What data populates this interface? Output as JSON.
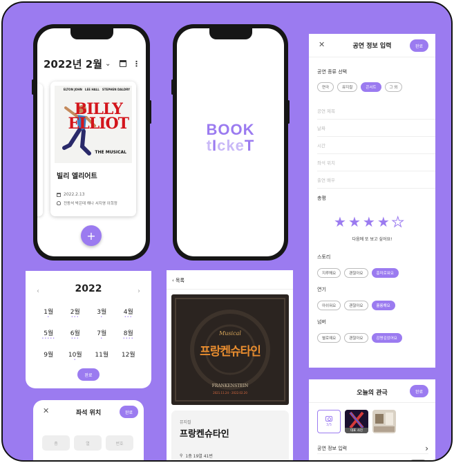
{
  "colors": {
    "accent": "#9b7bf0",
    "frame_border": "#111111"
  },
  "list_screen": {
    "month_title": "2022년 2월",
    "chevron_icon": "chevron-down-icon",
    "calendar_icon": "calendar-icon",
    "menu_icon": "kebab-menu-icon",
    "card": {
      "poster": {
        "cast": [
          "ELTON JOHN",
          "LEE HALL",
          "STEPHEN DALDRY"
        ],
        "title_line1": "BILLY",
        "title_line2": "ELLIOT",
        "subtitle": "THE MUSICAL"
      },
      "name": "빌리 엘리어트",
      "date": "2022.2.13",
      "cast": "전동석 박은태 해나 서지영 이희정"
    },
    "fab_label": "+"
  },
  "splash": {
    "logo_top": "BOOK",
    "logo_bottom": [
      "t",
      "I",
      "cke",
      "T"
    ]
  },
  "form": {
    "close": "✕",
    "title": "공연 정보 입력",
    "done": "완료",
    "type_label": "공연 종류 선택",
    "types": [
      {
        "label": "연극",
        "selected": false
      },
      {
        "label": "뮤지컬",
        "selected": false
      },
      {
        "label": "콘서트",
        "selected": true
      },
      {
        "label": "그 외",
        "selected": false
      }
    ],
    "fields": [
      "공연 제목",
      "날짜",
      "시간",
      "좌석 위치",
      "출연 배우"
    ],
    "review_label": "총평",
    "rating": 4,
    "rating_max": 5,
    "review_text": "다음에 또 보고 싶어요!",
    "groups": [
      {
        "label": "스토리",
        "options": [
          {
            "label": "지루해요",
            "selected": false
          },
          {
            "label": "괜찮아요",
            "selected": false
          },
          {
            "label": "흥미로워요",
            "selected": true
          }
        ]
      },
      {
        "label": "연기",
        "options": [
          {
            "label": "아쉬워요",
            "selected": false
          },
          {
            "label": "괜찮아요",
            "selected": false
          },
          {
            "label": "훌륭해요",
            "selected": true
          }
        ]
      },
      {
        "label": "넘버",
        "options": [
          {
            "label": "별로예요",
            "selected": false
          },
          {
            "label": "괜찮아요",
            "selected": false
          },
          {
            "label": "감명깊었어요",
            "selected": true
          }
        ]
      }
    ]
  },
  "calendar": {
    "year": "2022",
    "prev": "‹",
    "next": "›",
    "months": [
      {
        "label": "1월",
        "dots": 1
      },
      {
        "label": "2월",
        "dots": 3
      },
      {
        "label": "3월",
        "dots": 1
      },
      {
        "label": "4월",
        "dots": 3
      },
      {
        "label": "5월",
        "dots": 5
      },
      {
        "label": "6월",
        "dots": 3
      },
      {
        "label": "7월",
        "dots": 1
      },
      {
        "label": "8월",
        "dots": 4
      },
      {
        "label": "9월",
        "dots": 0
      },
      {
        "label": "10월",
        "dots": 1
      },
      {
        "label": "11월",
        "dots": 0
      },
      {
        "label": "12월",
        "dots": 0
      }
    ],
    "done": "완료"
  },
  "seat": {
    "close": "✕",
    "title": "좌석 위치",
    "done": "완료",
    "placeholders": [
      "층",
      "열",
      "번호"
    ]
  },
  "detail": {
    "back": "목록",
    "poster": {
      "musical": "Musical",
      "title": "프랑켄슈타인",
      "eng": "FRANKENSTEIN",
      "dates": "2021.11.24 - 2022.02.20"
    },
    "genre": "뮤지컬",
    "name": "프랑켄슈타인",
    "seat": "1층 19열 41번"
  },
  "today": {
    "title": "오늘의 관극",
    "done": "완료",
    "photo_count": "3/5",
    "rep_label": "대표 사진",
    "row_label": "공연 정보 입력"
  }
}
